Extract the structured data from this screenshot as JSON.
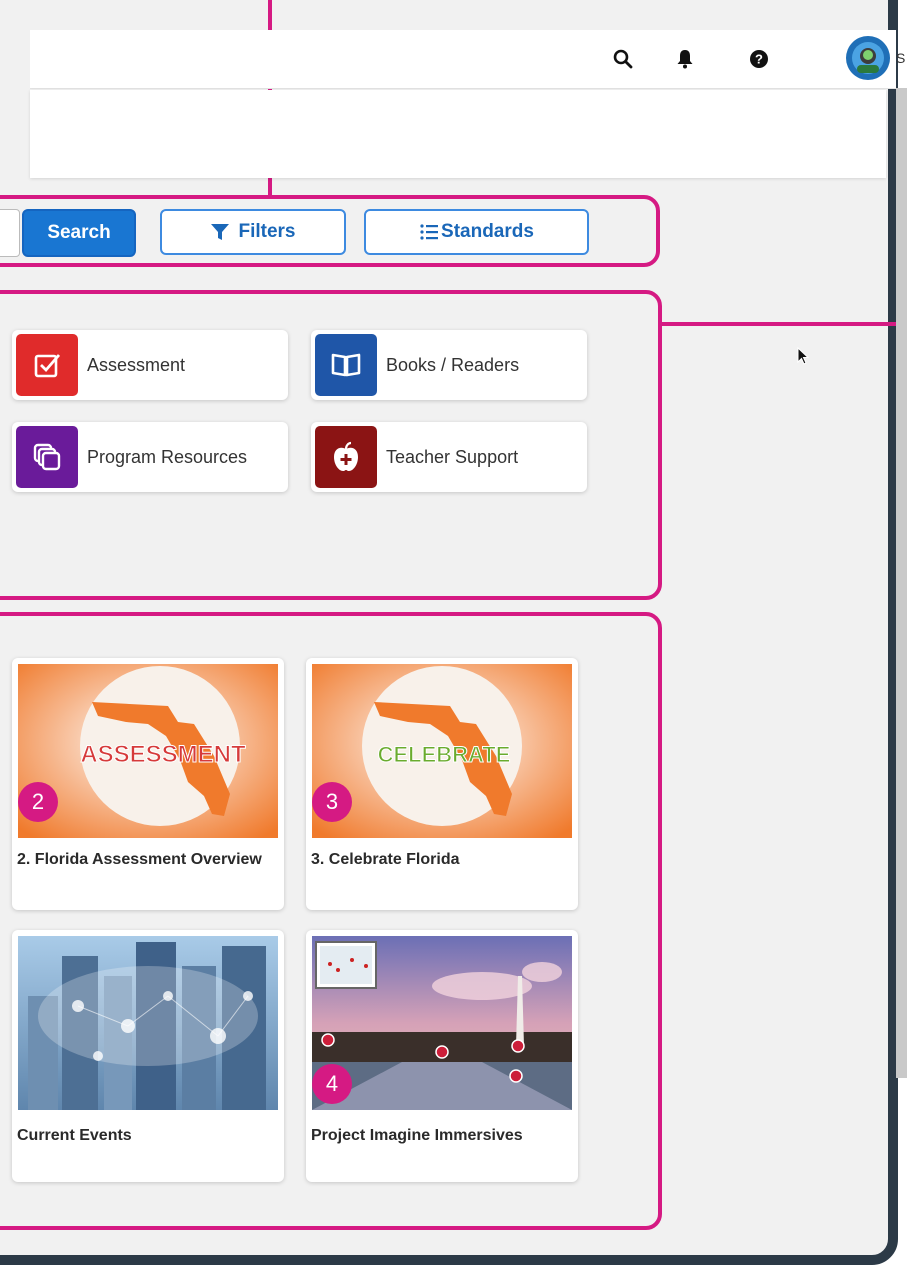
{
  "header": {
    "user_initial": "S",
    "icons": [
      "search-icon",
      "bell-icon",
      "help-icon",
      "avatar",
      "chevron-down-icon"
    ]
  },
  "toolbar": {
    "search_label": "Search",
    "filters_label": "Filters",
    "standards_label": "Standards"
  },
  "categories": [
    {
      "label": "Assessment",
      "icon": "checkbox-icon",
      "color": "#e02b2b"
    },
    {
      "label": "Books / Readers",
      "icon": "book-icon",
      "color": "#1f56a8"
    },
    {
      "label": "Program Resources",
      "icon": "layers-icon",
      "color": "#6a1b9a"
    },
    {
      "label": "Teacher Support",
      "icon": "apple-icon",
      "color": "#8b1414"
    }
  ],
  "tiles": [
    {
      "title": "2. Florida Assessment Overview",
      "badge": "2",
      "image_text": "ASSESSMENT"
    },
    {
      "title": "3. Celebrate Florida",
      "badge": "3",
      "image_text": "CELEBRATE"
    },
    {
      "title": "Current Events",
      "badge": ""
    },
    {
      "title": "Project Imagine Immersives",
      "badge": "4"
    }
  ],
  "colors": {
    "accent_pink": "#d51a83",
    "primary_blue": "#1976d2",
    "florida_orange": "#f07a2c"
  }
}
